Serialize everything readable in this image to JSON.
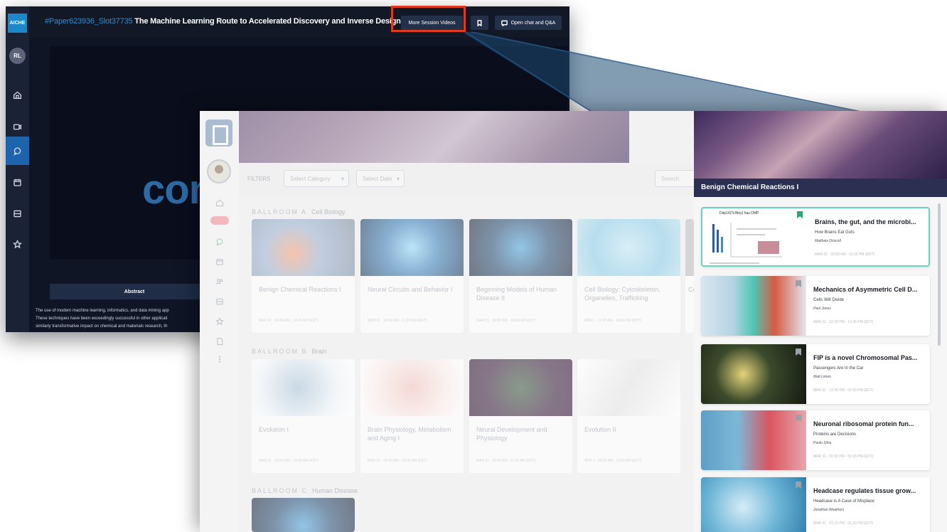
{
  "back_window": {
    "logo_label": "AICHE",
    "avatar_initials": "RL",
    "paper_tag": "#Paper623936_Slot37735",
    "video_title": "The Machine Learning Route to Accelerated Discovery and Inverse Design of C...",
    "more_session_videos_label": "More Session Videos",
    "open_chat_label": "Open chat and Q&A",
    "video_overlay_text": "con",
    "abstract_tab_label": "Abstract",
    "abstract_lines": [
      "The use of modern machine learning, informatics, and data mining app",
      "These techniques have been exceedingly successful in other applicati",
      "similarly transformative impact on chemical and materials research, th"
    ],
    "highlight_color": "#e23a1f"
  },
  "front_window": {
    "filters_label": "FILTERS",
    "select_category_placeholder": "Select Category",
    "select_date_placeholder": "Select Date",
    "search_placeholder": "Search",
    "sections": [
      {
        "room": "BALLROOM A",
        "topic": "Cell Biology",
        "sessions": [
          {
            "title": "Benign Chemical Reactions I",
            "time": "MAR 31 · 09:00 AM - 10:00 AM (EDT)"
          },
          {
            "title": "Neural Circuits and Behavior I",
            "time": "MAR 31 · 10:30 AM - 11:30 AM (EDT)"
          },
          {
            "title": "Beginning Models of Human Disease II",
            "time": "MAR 31 · 09:00 AM - 10:00 AM (EDT)"
          },
          {
            "title": "Cell Biology: Cytoskeleton, Organelles, Trafficking",
            "time": "APR 1 · 11:00 AM - 12:00 PM (EDT)"
          },
          {
            "title": "Ce",
            "time": ""
          }
        ]
      },
      {
        "room": "BALLROOM B",
        "topic": "Brain",
        "sessions": [
          {
            "title": "Evolution I",
            "time": "MAR 31 · 09:00 AM - 10:00 AM (EDT)"
          },
          {
            "title": "Brain Physiology, Metabolism and Aging I",
            "time": "MAR 31 · 09:00 AM - 10:00 AM (EDT)"
          },
          {
            "title": "Neural Development and Physiology",
            "time": "MAR 31 · 10:00 AM - 11:00 AM (EDT)"
          },
          {
            "title": "Evolution II",
            "time": "APR 1 · 09:00 AM - 10:00 AM (EDT)"
          }
        ]
      },
      {
        "room": "BALLROOM C",
        "topic": "Human Disease",
        "sessions": []
      }
    ]
  },
  "right_panel": {
    "title": "Benign Chemical Reactions I",
    "chart_thumb_title": "Ddp16(TcINey) has DMP",
    "cards": [
      {
        "title": "Brains, the gut, and the microbi...",
        "subtitle": "How Brains Eat Guts",
        "author": "Matthew Driscoll",
        "time": "MAR 31 · 09:00 AM - 03:15 PM (EDT)"
      },
      {
        "title": "Mechanics of Asymmetric Cell D...",
        "subtitle": "Cells Will Divide",
        "author": "Paul Jones",
        "time": "MAR 31 · 12:30 PM - 12:45 PM (EDT)"
      },
      {
        "title": "FIP is a novel Chromosomal Pas...",
        "subtitle": "Passengers Are In the Car",
        "author": "Matt Limon",
        "time": "MAR 31 · 12:45 PM - 01:00 PM (EDT)"
      },
      {
        "title": "Neuronal ribosomal protein fun...",
        "subtitle": "Proteins are Decisions",
        "author": "Paulo Silva",
        "time": "MAR 31 · 01:00 PM - 01:15 PM (EDT)"
      },
      {
        "title": "Headcase regulates tissue grow...",
        "subtitle": "Headcase is A Case of Misplace",
        "author": "Jonathan Weathers",
        "time": "MAR 31 · 01:15 PM - 01:30 PM (EDT)"
      }
    ]
  },
  "colors": {
    "accent_blue": "#1e64ad",
    "panel_title_bg": "#2b2f52",
    "selected_card_border": "#6ed0c3"
  }
}
